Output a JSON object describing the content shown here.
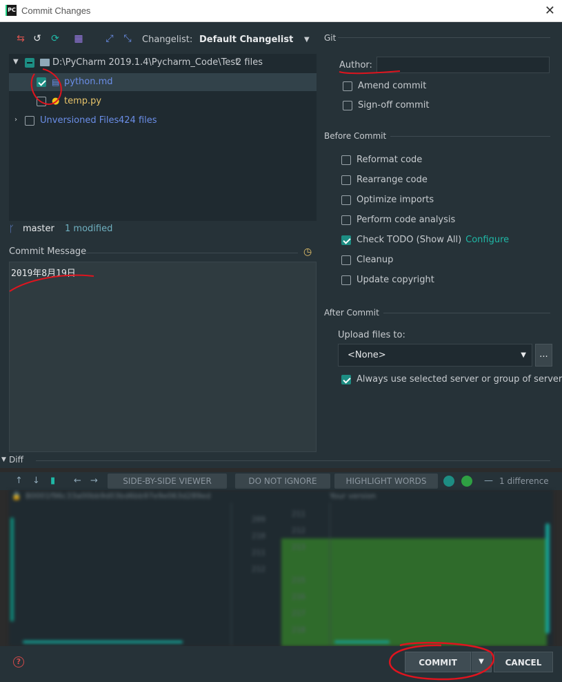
{
  "window": {
    "app_icon": "pycharm-icon",
    "title": "Commit Changes",
    "close_glyph": "✕"
  },
  "toolbar": {
    "changelist_label": "Changelist:",
    "changelist_value": "Default Changelist"
  },
  "tree": {
    "root": {
      "path": "D:\\PyCharm 2019.1.4\\Pycharm_Code\\Test",
      "count": "2 files"
    },
    "files": [
      {
        "name": "python.md",
        "checked": true
      },
      {
        "name": "temp.py",
        "checked": false
      }
    ],
    "unversioned": {
      "label": "Unversioned Files",
      "count": "424 files"
    }
  },
  "branch": {
    "name": "master",
    "modified": "1 modified"
  },
  "commit_message": {
    "label": "Commit Message",
    "text": "2019年8月19日"
  },
  "git": {
    "title": "Git",
    "author_label": "Author:",
    "author_value": "",
    "amend": "Amend commit",
    "signoff": "Sign-off commit"
  },
  "before_commit": {
    "title": "Before Commit",
    "options": [
      {
        "label": "Reformat code",
        "checked": false
      },
      {
        "label": "Rearrange code",
        "checked": false
      },
      {
        "label": "Optimize imports",
        "checked": false
      },
      {
        "label": "Perform code analysis",
        "checked": false
      },
      {
        "label": "Check TODO (Show All)",
        "checked": true
      },
      {
        "label": "Cleanup",
        "checked": false
      },
      {
        "label": "Update copyright",
        "checked": false
      }
    ],
    "configure_link": "Configure"
  },
  "after_commit": {
    "title": "After Commit",
    "upload_label": "Upload files to:",
    "upload_value": "<None>",
    "more": "...",
    "always_use": "Always use selected server or group of servers"
  },
  "diff": {
    "title": "Diff",
    "viewer": "SIDE-BY-SIDE VIEWER",
    "ignore": "DO NOT IGNORE",
    "highlight": "HIGHLIGHT WORDS",
    "count": "1 difference",
    "left_path": "B0001f96c33a00bb9d03bd6bb97e9e063d289ed",
    "right_path": "Your version"
  },
  "buttons": {
    "help": "?",
    "commit": "COMMIT",
    "cancel": "CANCEL"
  },
  "colors": {
    "accent": "#1d8d83",
    "panel": "#263238",
    "annotation": "#e0141e"
  }
}
